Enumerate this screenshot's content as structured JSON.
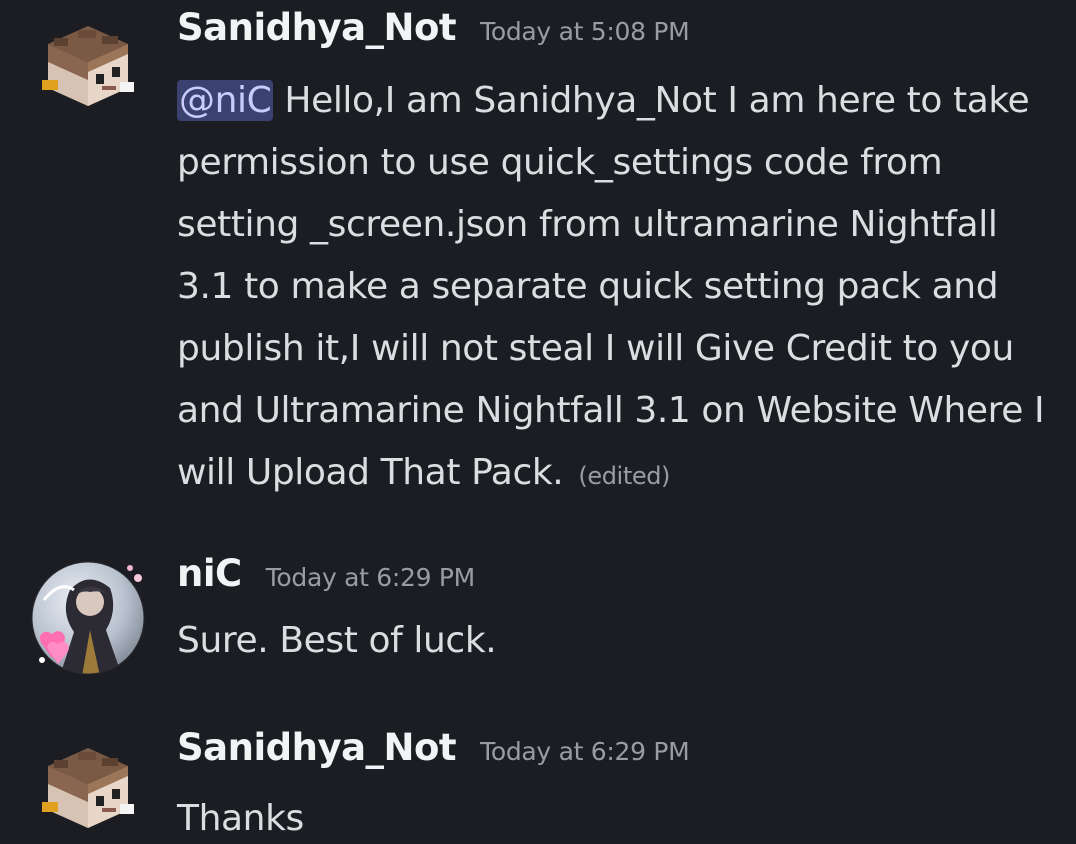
{
  "messages": [
    {
      "author": "Sanidhya_Not",
      "timestamp": "Today at 5:08 PM",
      "mention": "@niC",
      "text": "Hello,I am Sanidhya_Not I am here to take permission to use quick_settings code from setting _screen.json from ultramarine Nightfall 3.1 to make a separate quick setting pack and publish it,I will not steal I will Give Credit to you and Ultramarine Nightfall 3.1 on Website Where I will Upload That Pack.",
      "edited_label": "(edited)"
    },
    {
      "author": "niC",
      "timestamp": "Today at 6:29 PM",
      "text": "Sure. Best of luck."
    },
    {
      "author": "Sanidhya_Not",
      "timestamp": "Today at 6:29 PM",
      "text": "Thanks"
    }
  ],
  "colors": {
    "background": "#1c1d22",
    "username": "#f2f3f5",
    "timestamp": "#9a9ca5",
    "message_text": "#dbdee1",
    "mention_bg": "#3c4270",
    "mention_text": "#c9cdfb"
  }
}
